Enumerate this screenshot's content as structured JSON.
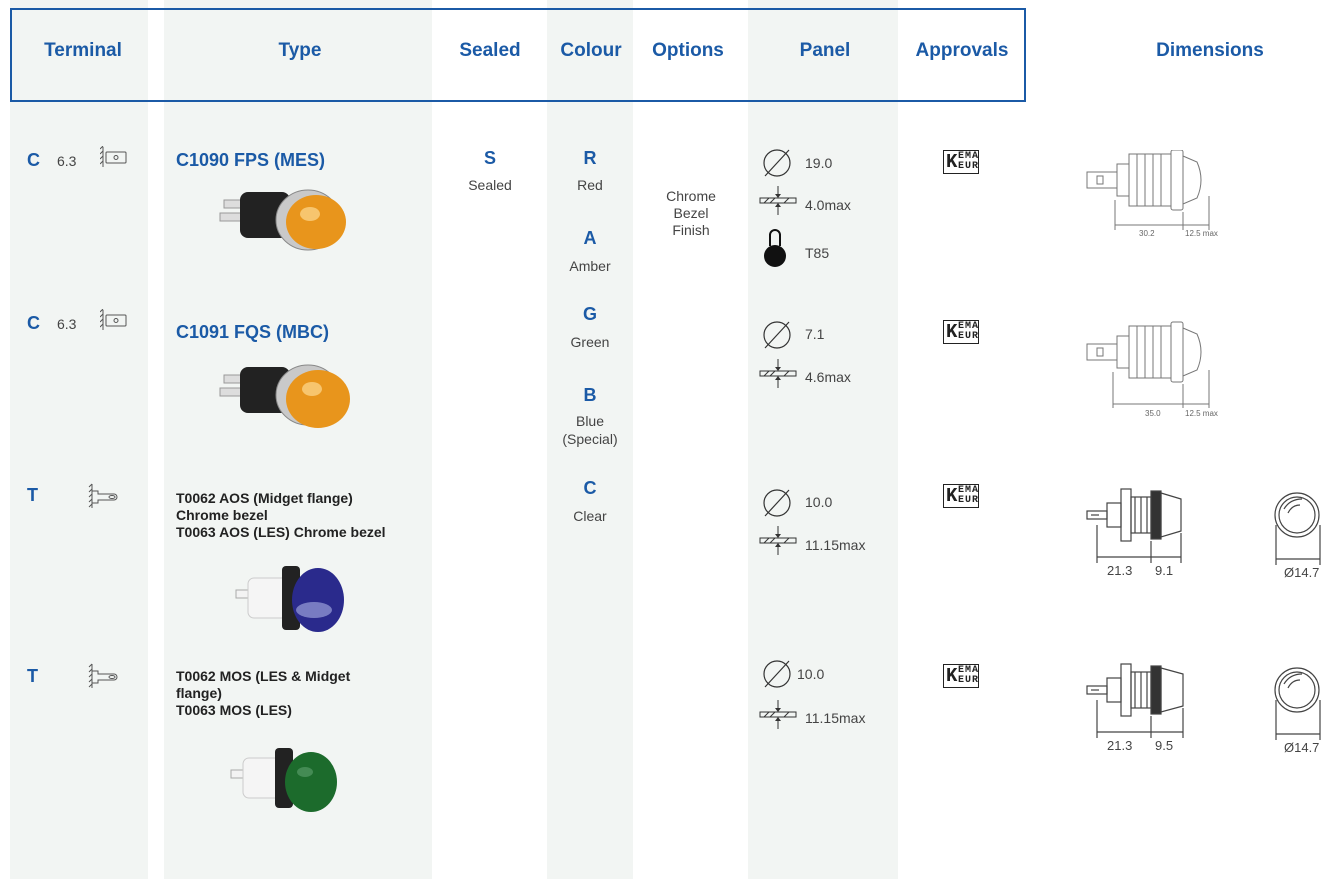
{
  "headers": {
    "terminal": "Terminal",
    "type": "Type",
    "sealed": "Sealed",
    "colour": "Colour",
    "options": "Options",
    "panel": "Panel",
    "approvals": "Approvals",
    "dimensions": "Dimensions"
  },
  "rows": [
    {
      "terminal_code": "C",
      "terminal_size": "6.3",
      "type": "C1090 FPS (MES)",
      "panel": {
        "diameter": "19.0",
        "thickness": "4.0max",
        "temp": "T85"
      },
      "approval_icon": "kema-keur-mark",
      "dims": [
        "30.2",
        "12.5 max"
      ]
    },
    {
      "terminal_code": "C",
      "terminal_size": "6.3",
      "type": "C1091 FQS (MBC)",
      "panel": {
        "diameter": "7.1",
        "thickness": "4.6max"
      },
      "approval_icon": "kema-keur-mark",
      "dims": [
        "35.0",
        "12.5 max"
      ]
    },
    {
      "terminal_code": "T",
      "terminal_size": "",
      "type_lines": [
        "T0062 AOS (Midget flange)",
        "Chrome bezel",
        "T0063 AOS (LES) Chrome bezel"
      ],
      "panel": {
        "diameter": "10.0",
        "thickness": "11.15max"
      },
      "approval_icon": "kema-keur-mark",
      "dims": [
        "21.3",
        "9.1",
        "Ø14.7"
      ]
    },
    {
      "terminal_code": "T",
      "terminal_size": "",
      "type_lines": [
        "T0062 MOS (LES & Midget",
        "flange)",
        "T0063 MOS (LES)"
      ],
      "panel": {
        "diameter": "10.0",
        "thickness": "11.15max"
      },
      "approval_icon": "kema-keur-mark",
      "dims": [
        "21.3",
        "9.5",
        "Ø14.7"
      ]
    }
  ],
  "sealed": {
    "code": "S",
    "label": "Sealed"
  },
  "colours": [
    {
      "code": "R",
      "label": "Red"
    },
    {
      "code": "A",
      "label": "Amber"
    },
    {
      "code": "G",
      "label": "Green"
    },
    {
      "code": "B",
      "label": "Blue",
      "label2": "(Special)"
    },
    {
      "code": "C",
      "label": "Clear"
    }
  ],
  "options": [
    "Chrome",
    "Bezel",
    "Finish"
  ],
  "kema": {
    "k": "K",
    "top": "EMA",
    "bottom": "EUR"
  },
  "colors": {
    "brand": "#1b5aa6",
    "column_bg": "#f2f5f3",
    "amber": "#e8951c",
    "blue": "#2a2a8c",
    "green": "#1c6b2c"
  }
}
